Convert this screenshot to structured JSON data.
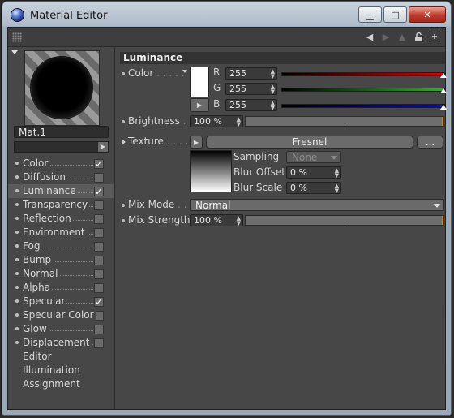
{
  "window": {
    "title": "Material Editor",
    "minimize": "▁",
    "maximize": "□",
    "close": "✕"
  },
  "toolbar": {
    "icons": [
      "back-icon",
      "forward-icon",
      "up-icon",
      "lock-icon",
      "new-window-icon"
    ]
  },
  "material": {
    "name": "Mat.1"
  },
  "channels": [
    {
      "label": "Color",
      "checked": true,
      "active": false,
      "bullet": true
    },
    {
      "label": "Diffusion",
      "checked": false,
      "active": false,
      "bullet": true
    },
    {
      "label": "Luminance",
      "checked": true,
      "active": true,
      "bullet": true
    },
    {
      "label": "Transparency",
      "checked": false,
      "active": false,
      "bullet": true
    },
    {
      "label": "Reflection",
      "checked": false,
      "active": false,
      "bullet": true
    },
    {
      "label": "Environment",
      "checked": false,
      "active": false,
      "bullet": true
    },
    {
      "label": "Fog",
      "checked": false,
      "active": false,
      "bullet": true
    },
    {
      "label": "Bump",
      "checked": false,
      "active": false,
      "bullet": true
    },
    {
      "label": "Normal",
      "checked": false,
      "active": false,
      "bullet": true
    },
    {
      "label": "Alpha",
      "checked": false,
      "active": false,
      "bullet": true
    },
    {
      "label": "Specular",
      "checked": true,
      "active": false,
      "bullet": true
    },
    {
      "label": "Specular Color",
      "checked": false,
      "active": false,
      "bullet": true
    },
    {
      "label": "Glow",
      "checked": false,
      "active": false,
      "bullet": true
    },
    {
      "label": "Displacement",
      "checked": false,
      "active": false,
      "bullet": true
    },
    {
      "label": "Editor",
      "checked": null,
      "active": false,
      "bullet": false
    },
    {
      "label": "Illumination",
      "checked": null,
      "active": false,
      "bullet": false
    },
    {
      "label": "Assignment",
      "checked": null,
      "active": false,
      "bullet": false
    }
  ],
  "luminance": {
    "title": "Luminance",
    "color_label": "Color",
    "color_swatch": "#ffffff",
    "r_label": "R",
    "r_value": "255",
    "g_label": "G",
    "g_value": "255",
    "b_label": "B",
    "b_value": "255",
    "brightness_label": "Brightness",
    "brightness_value": "100 %",
    "texture_label": "Texture",
    "texture_name": "Fresnel",
    "texture_more": "...",
    "sampling_label": "Sampling",
    "sampling_value": "None",
    "blur_offset_label": "Blur Offset",
    "blur_offset_value": "0 %",
    "blur_scale_label": "Blur Scale",
    "blur_scale_value": "0 %",
    "mix_mode_label": "Mix Mode",
    "mix_mode_value": "Normal",
    "mix_strength_label": "Mix Strength",
    "mix_strength_value": "100 %"
  }
}
